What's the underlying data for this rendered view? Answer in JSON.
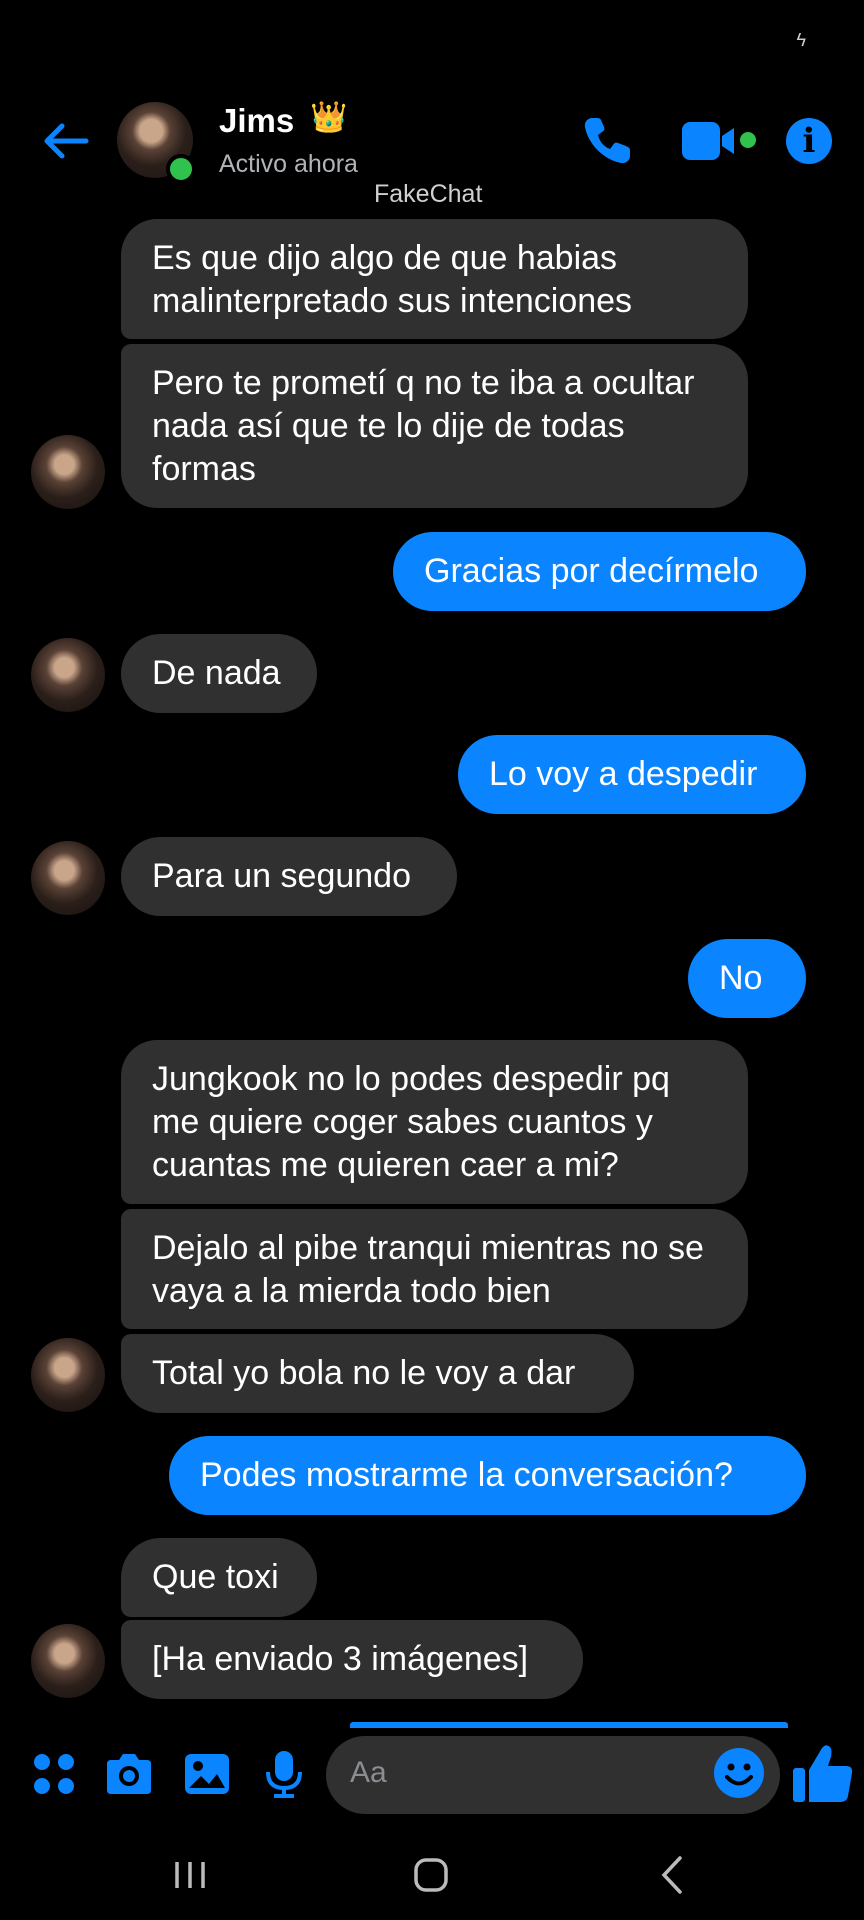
{
  "status_bar": {
    "icon": "charging-bolt-icon"
  },
  "header": {
    "contact_name": "Jims",
    "crown_emoji": "👑",
    "status": "Activo ahora",
    "icons": [
      "back-arrow-icon",
      "phone-icon",
      "video-camera-icon",
      "info-icon"
    ]
  },
  "watermark": "FakeChat",
  "messages": [
    {
      "side": "in",
      "text": "Es que dijo algo de que habias malinterpretado sus intenciones"
    },
    {
      "side": "in",
      "text": "Pero te prometí q no te iba a ocultar nada así que te lo dije de todas formas"
    },
    {
      "side": "out",
      "text": "Gracias por decírmelo"
    },
    {
      "side": "in",
      "text": "De nada"
    },
    {
      "side": "out",
      "text": "Lo voy a despedir"
    },
    {
      "side": "in",
      "text": "Para un segundo"
    },
    {
      "side": "out",
      "text": "No"
    },
    {
      "side": "in",
      "text": "Jungkook no lo podes despedir pq me quiere coger sabes cuantos y cuantas me quieren caer a mi?"
    },
    {
      "side": "in",
      "text": "Dejalo al pibe tranqui mientras no se vaya a la mierda todo bien"
    },
    {
      "side": "in",
      "text": "Total yo bola no le voy a dar"
    },
    {
      "side": "out",
      "text": "Podes mostrarme la conversación?"
    },
    {
      "side": "in",
      "text": "Que toxi"
    },
    {
      "side": "in",
      "text": "[Ha enviado 3 imágenes]"
    }
  ],
  "composer": {
    "placeholder": "Aa",
    "icons": [
      "apps-grid-icon",
      "camera-icon",
      "gallery-icon",
      "microphone-icon",
      "emoji-icon",
      "thumbs-up-icon"
    ]
  },
  "colors": {
    "accent": "#0a84ff",
    "incoming_bubble": "#303030",
    "online": "#31c24d",
    "background": "#000000"
  }
}
